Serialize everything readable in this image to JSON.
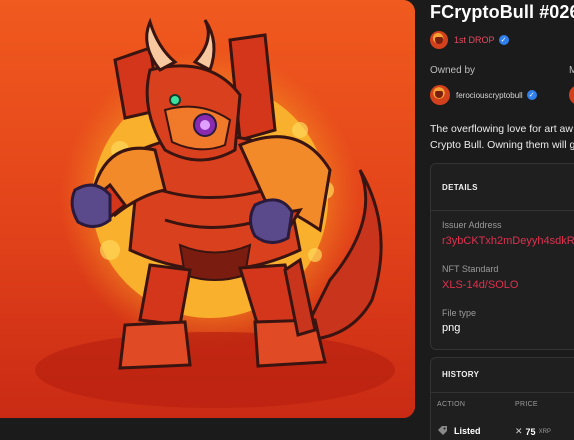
{
  "nft": {
    "title": "FCryptoBull #026",
    "drop_label": "1st DROP",
    "owned_by_label": "Owned by",
    "second_column_label_partial": "M",
    "owner_name": "ferociouscryptobull",
    "description_lines": [
      "The overflowing love for art aw",
      "Crypto Bull. Owning them will g"
    ]
  },
  "details": {
    "title": "DETAILS",
    "issuer_label": "Issuer Address",
    "issuer_value": "r3ybCKTxh2mDeyyh4sdkR",
    "standard_label": "NFT Standard",
    "standard_value": "XLS-14d/SOLO",
    "file_type_label": "File type",
    "file_type_value": "png"
  },
  "history": {
    "title": "HISTORY",
    "columns": [
      "ACTION",
      "PRICE"
    ],
    "rows": [
      {
        "action": "Listed",
        "price": "75",
        "currency": "XRP"
      }
    ]
  },
  "icons": {
    "verified": "verified-check-icon",
    "tag": "tag-icon",
    "xrp": "xrp-icon",
    "avatar": "bull-avatar-icon"
  },
  "colors": {
    "background": "#1b1b1b",
    "accent_red": "#e0304e",
    "verified_blue": "#2f80ed",
    "art_orange": "#e2451a"
  }
}
